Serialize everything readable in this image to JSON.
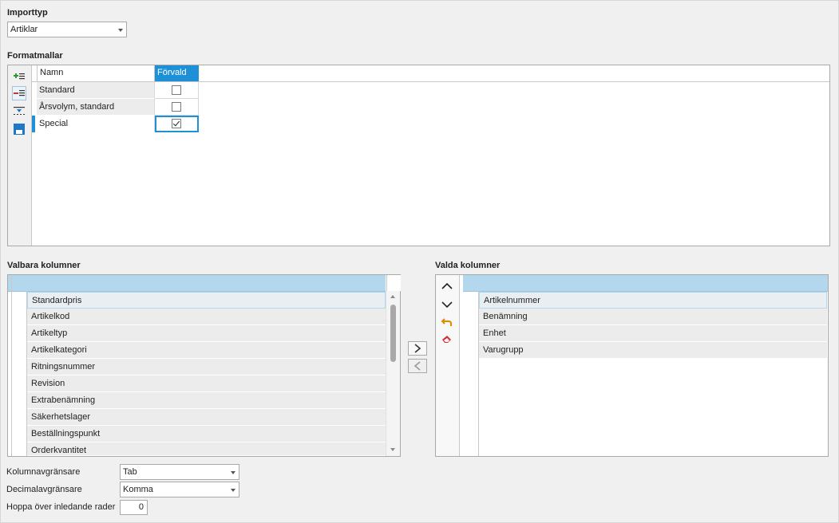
{
  "importtyp": {
    "label": "Importtyp",
    "value": "Artiklar"
  },
  "formatmallar": {
    "label": "Formatmallar",
    "columns": {
      "namn": "Namn",
      "forvald": "Förvald"
    },
    "rows": [
      {
        "namn": "Standard",
        "forvald": false
      },
      {
        "namn": "Årsvolym, standard",
        "forvald": false
      },
      {
        "namn": "Special",
        "forvald": true
      }
    ]
  },
  "valbara": {
    "label": "Valbara kolumner",
    "items": [
      "Standardpris",
      "Artikelkod",
      "Artikeltyp",
      "Artikelkategori",
      "Ritningsnummer",
      "Revision",
      "Extrabenämning",
      "Säkerhetslager",
      "Beställningspunkt",
      "Orderkvantitet"
    ]
  },
  "valda": {
    "label": "Valda kolumner",
    "items": [
      "Artikelnummer",
      "Benämning",
      "Enhet",
      "Varugrupp"
    ]
  },
  "settings": {
    "kolumnavgransare": {
      "label": "Kolumnavgränsare",
      "value": "Tab"
    },
    "decimalavgransare": {
      "label": "Decimalavgränsare",
      "value": "Komma"
    },
    "hoppa": {
      "label": "Hoppa över inledande rader",
      "value": "0"
    }
  },
  "colors": {
    "accent": "#1e90d8",
    "list_header": "#b3d7ec",
    "row_bg": "#ececec"
  },
  "icons": {
    "fm_toolbar": [
      "add-row-icon",
      "delete-row-icon",
      "download-icon",
      "save-icon"
    ],
    "valda_toolbar": [
      "move-up-icon",
      "move-down-icon",
      "undo-icon",
      "eraser-icon"
    ],
    "transfer": [
      "arrow-right-icon",
      "arrow-left-icon"
    ]
  }
}
